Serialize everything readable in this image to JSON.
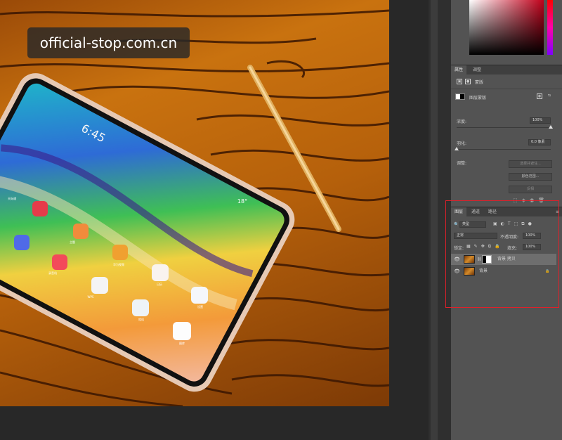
{
  "watermark": "official-stop.com.cn",
  "tablet": {
    "clock": "6:45",
    "weather": "18°",
    "apps": [
      "主题",
      "华为视频",
      "录音机",
      "WPS",
      "日历",
      "设置",
      "相机",
      "图库",
      "天际通"
    ]
  },
  "properties_panel": {
    "tabs": [
      "属性",
      "调整"
    ],
    "type_label": "蒙版",
    "mask_name": "图层蒙版",
    "density_label": "浓度:",
    "density_value": "100%",
    "density_fraction": 1.0,
    "feather_label": "羽化:",
    "feather_value": "0.0 像素",
    "feather_fraction": 0.0,
    "refine_label": "调整:",
    "buttons": [
      "选择并遮住...",
      "颜色范围...",
      "反相"
    ]
  },
  "layers_panel": {
    "tabs": [
      "图层",
      "通道",
      "路径"
    ],
    "filter_kind": "类型",
    "blend_mode": "正常",
    "opacity_label": "不透明度:",
    "opacity_value": "100%",
    "lock_label": "锁定:",
    "fill_label": "填充:",
    "fill_value": "100%",
    "layers": [
      {
        "name": "背景 拷贝",
        "selected": true,
        "has_mask": true,
        "locked": false
      },
      {
        "name": "背景",
        "selected": false,
        "has_mask": false,
        "locked": true
      }
    ]
  },
  "colors": {
    "highlight_border": "#e0202a",
    "panel_bg": "#535353",
    "canvas_bg": "#282828"
  }
}
